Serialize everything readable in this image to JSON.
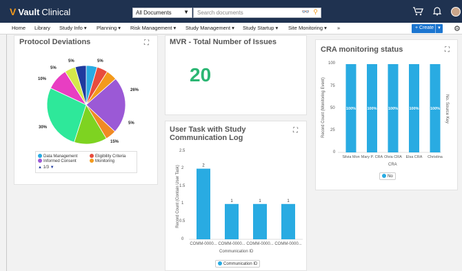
{
  "app": {
    "brand": "Vault",
    "product": "Clinical"
  },
  "search": {
    "scope": "All Documents",
    "placeholder": "Search documents"
  },
  "nav": {
    "items": [
      "Home",
      "Library",
      "Study Info ▾",
      "Planning ▾",
      "Risk Management ▾",
      "Study Management ▾",
      "Study Startup ▾",
      "Site Monitoring ▾",
      "»"
    ],
    "create_label": "+ Create"
  },
  "icons": {
    "logo": "vault-v-logo",
    "binoculars": "binoculars-icon",
    "search": "search-icon",
    "cart": "cart-icon",
    "bell": "bell-icon",
    "gear": "gear-icon",
    "expand": "expand-icon"
  },
  "colors": {
    "accent": "#f39a1c",
    "topbar": "#1f3250",
    "primary": "#1b75d0",
    "metric": "#2bb673",
    "bar": "#29abe2"
  },
  "protocol_deviations": {
    "title": "Protocol Deviations",
    "slice_labels": [
      "5%",
      "5%",
      "5%",
      "10%",
      "26%",
      "5%",
      "15%",
      "30%"
    ],
    "legend": [
      {
        "label": "Data Management",
        "color": "#29abe2"
      },
      {
        "label": "Eligibility Criteria",
        "color": "#e84c3d"
      },
      {
        "label": "Informed Consent",
        "color": "#9b59d6"
      },
      {
        "label": "Monitoring",
        "color": "#f39a1c"
      }
    ],
    "pager": "1/3"
  },
  "mvr": {
    "title": "MVR - Total Number of Issues",
    "value": "20"
  },
  "user_task": {
    "title_line1": "User Task with Study",
    "title_line2": "Communication Log",
    "y_ticks": [
      "2.5",
      "2",
      "1.5",
      "1",
      "0.5",
      "0"
    ],
    "ylabel": "Record Count (Contain User Task)",
    "xlabel": "Communication ID",
    "legend": "Communication ID"
  },
  "cra": {
    "title": "CRA monitoring status",
    "y_ticks": [
      "100",
      "75",
      "50",
      "25",
      "0"
    ],
    "ylabel": "Record Count (Monitoring Event)",
    "right_label": "No. Source Key",
    "xlabel": "CRA",
    "legend": "No"
  },
  "chart_data": [
    {
      "type": "pie",
      "title": "Protocol Deviations",
      "slices": [
        {
          "label": "",
          "value": 5,
          "color": "#29abe2"
        },
        {
          "label": "",
          "value": 5,
          "color": "#e84c3d"
        },
        {
          "label": "",
          "value": 5,
          "color": "#f39a1c"
        },
        {
          "label": "",
          "value": 26,
          "color": "#9b59d6"
        },
        {
          "label": "",
          "value": 5,
          "color": "#f08a24"
        },
        {
          "label": "",
          "value": 15,
          "color": "#7ed321"
        },
        {
          "label": "",
          "value": 30,
          "color": "#2ee89a"
        },
        {
          "label": "",
          "value": 10,
          "color": "#e83ec2"
        },
        {
          "label": "",
          "value": 5,
          "color": "#d4e84a"
        },
        {
          "label": "",
          "value": 5,
          "color": "#1f3a9e"
        }
      ]
    },
    {
      "type": "bar",
      "title": "User Task with Study Communication Log",
      "categories": [
        "COMM-0000...",
        "COMM-0000...",
        "COMM-0000...",
        "COMM-0000..."
      ],
      "values": [
        2,
        1,
        1,
        1
      ],
      "ylim": [
        0,
        2.5
      ],
      "ylabel": "Record Count (Contain User Task)",
      "xlabel": "Communication ID"
    },
    {
      "type": "bar",
      "title": "CRA monitoring status",
      "categories": [
        "Silvia Mon",
        "Mary P. CRA",
        "Olvia CRA",
        "Elsa CRA",
        "Christina"
      ],
      "series": [
        {
          "name": "No",
          "values": [
            100,
            100,
            100,
            100,
            100
          ]
        }
      ],
      "bar_labels": [
        "100%",
        "100%",
        "100%",
        "100%",
        "100%"
      ],
      "ylim": [
        0,
        100
      ],
      "ylabel": "Record Count (Monitoring Event)",
      "xlabel": "CRA"
    }
  ]
}
